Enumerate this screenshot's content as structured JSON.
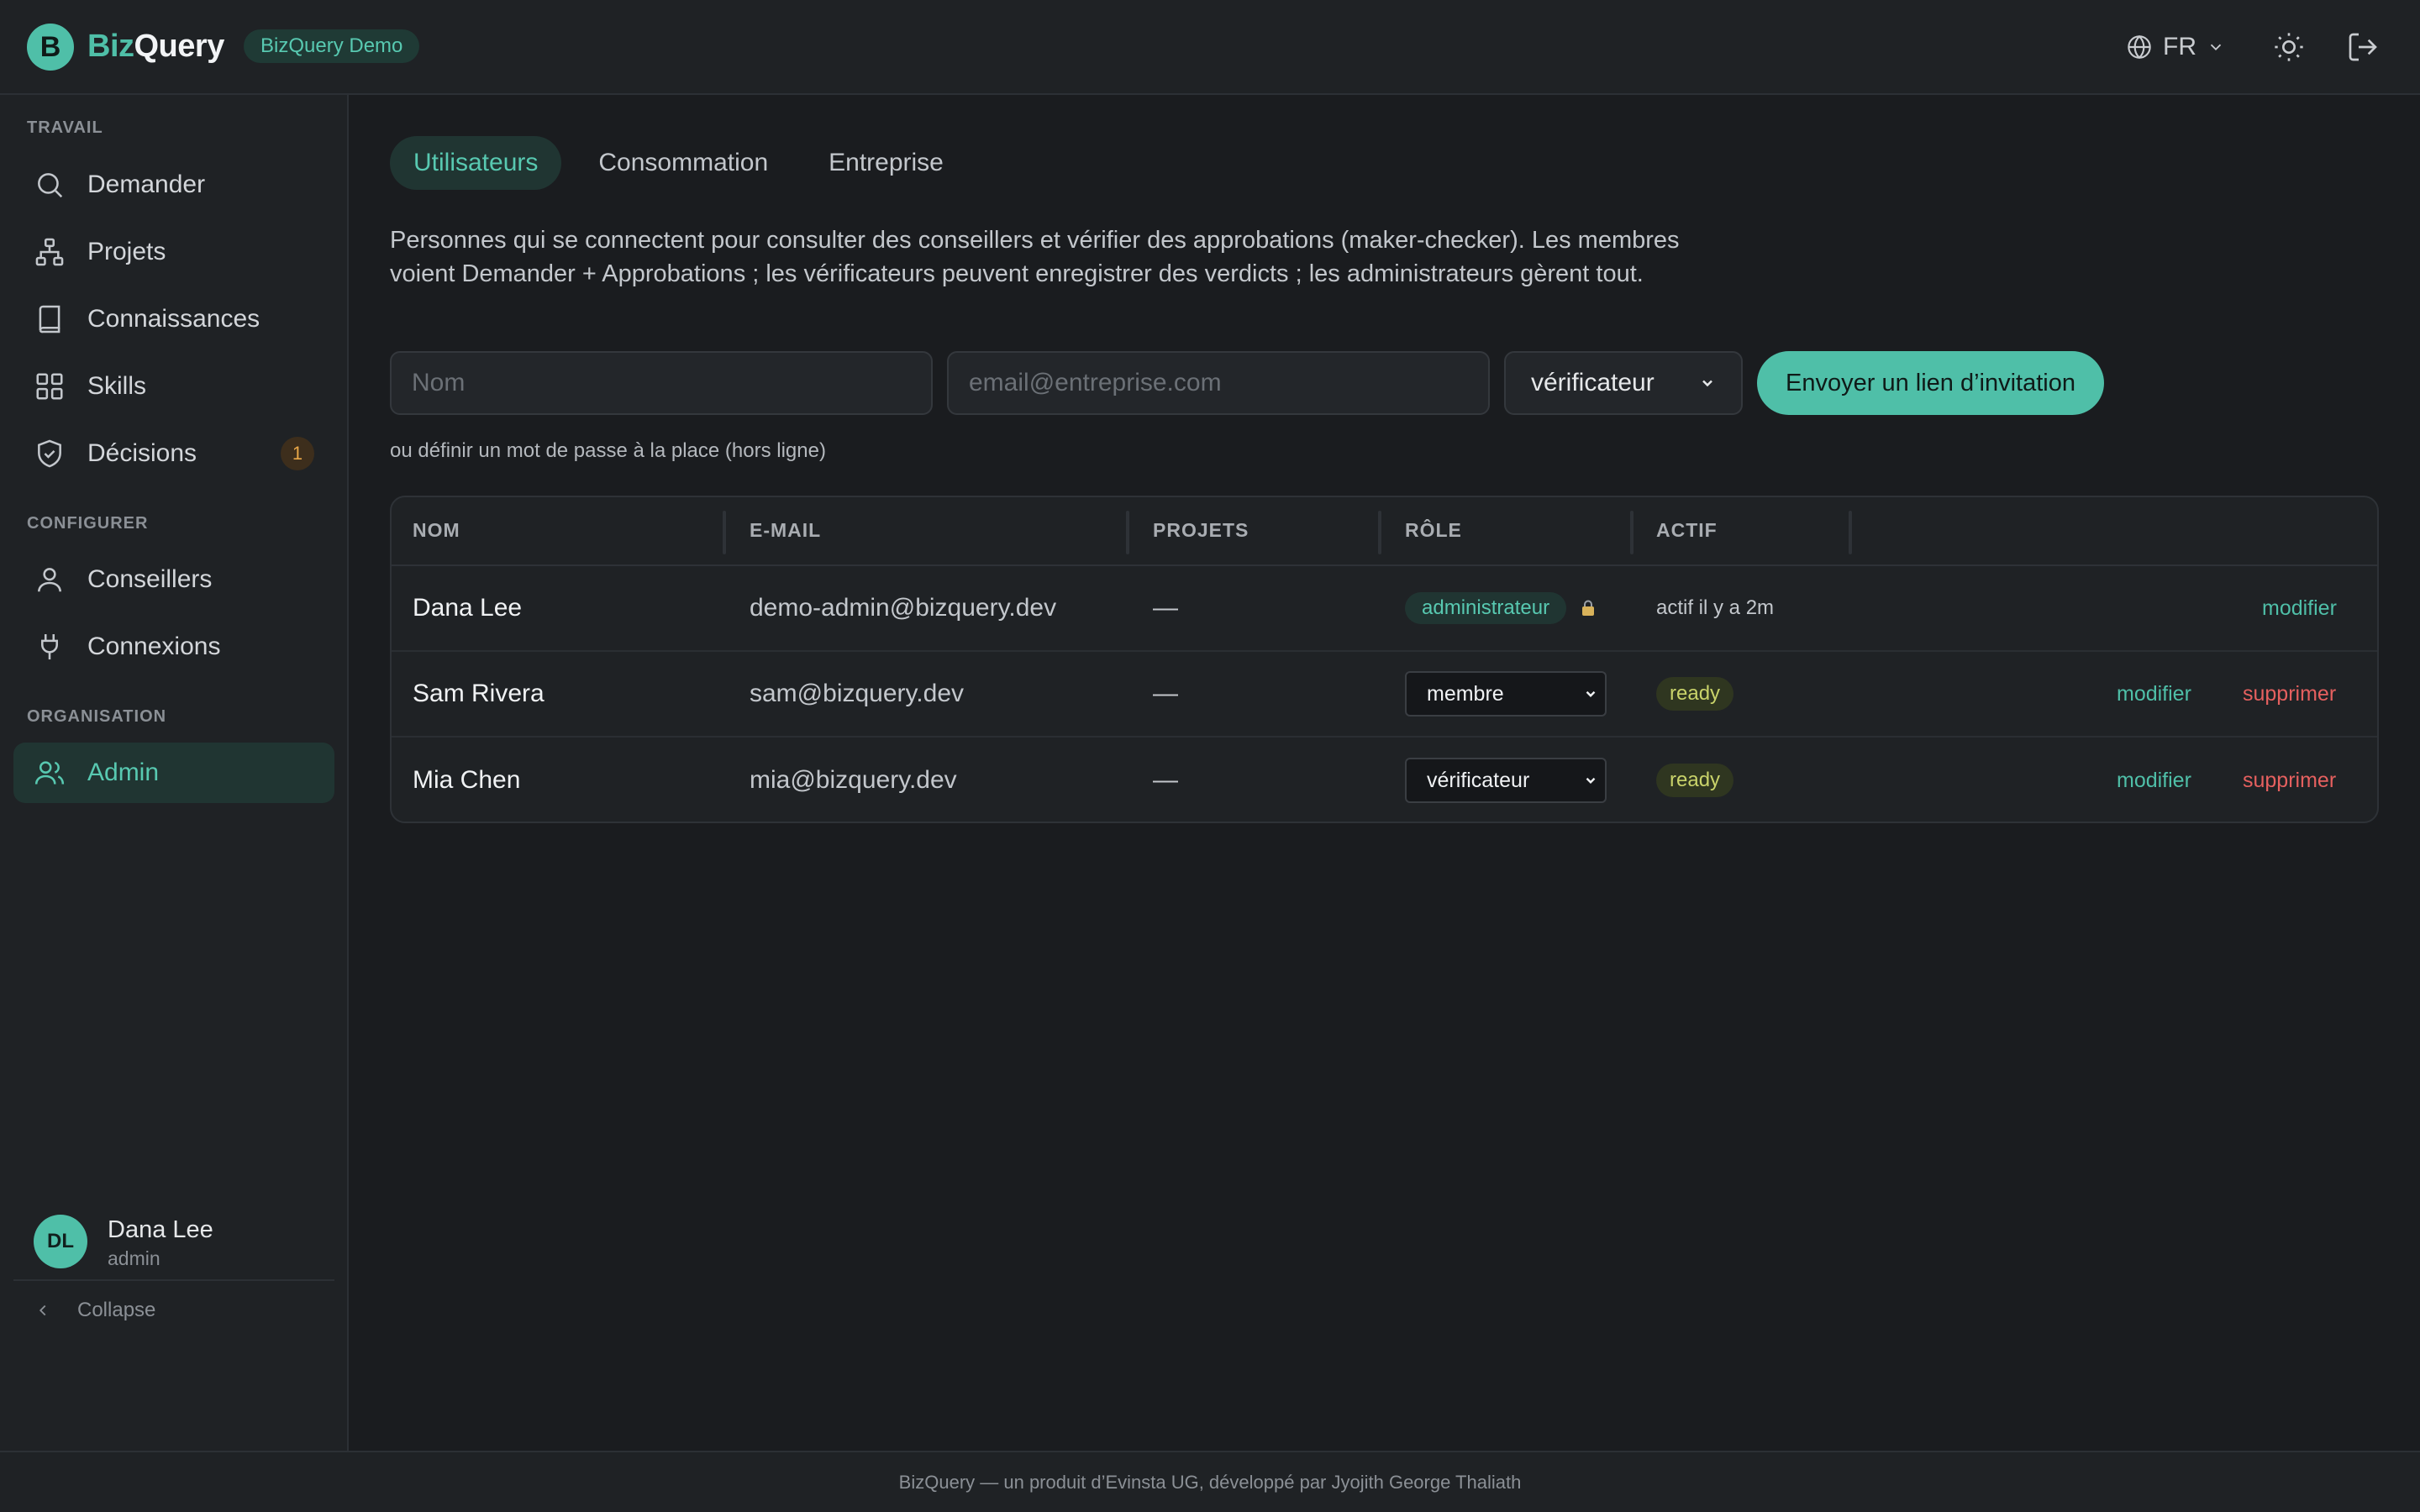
{
  "app": {
    "logo_letter": "B",
    "brand_part1": "Biz",
    "brand_part2": "Query",
    "demo_badge": "BizQuery Demo",
    "language": "FR",
    "accent_color": "#4fbfa8"
  },
  "topbar": {
    "icons": [
      "globe-icon",
      "chevron-down-icon",
      "sun-icon",
      "logout-icon"
    ]
  },
  "sidebar": {
    "sections": {
      "work": "TRAVAIL",
      "configure": "CONFIGURER",
      "organisation": "ORGANISATION"
    },
    "items": {
      "ask": "Demander",
      "projects": "Projets",
      "knowledge": "Connaissances",
      "skills": "Skills",
      "decisions": "Décisions",
      "decisions_badge": "1",
      "advisors": "Conseillers",
      "connections": "Connexions",
      "admin": "Admin"
    },
    "user": {
      "initials": "DL",
      "name": "Dana Lee",
      "role": "admin"
    },
    "collapse_label": "Collapse"
  },
  "tabs": {
    "users": "Utilisateurs",
    "consumption": "Consommation",
    "company": "Entreprise"
  },
  "description": "Personnes qui se connectent pour consulter des conseillers et vérifier des approbations (maker-checker). Les membres voient Demander + Approbations ; les vérificateurs peuvent enregistrer des verdicts ; les administrateurs gèrent tout.",
  "invite": {
    "name_placeholder": "Nom",
    "email_placeholder": "email@entreprise.com",
    "role_selected": "vérificateur",
    "send_label": "Envoyer un lien d’invitation",
    "password_note": "ou définir un mot de passe à la place (hors ligne)"
  },
  "table": {
    "headers": {
      "name": "NOM",
      "email": "E-MAIL",
      "projects": "PROJETS",
      "role": "RÔLE",
      "active": "ACTIF"
    },
    "rows": [
      {
        "name": "Dana Lee",
        "email": "demo-admin@bizquery.dev",
        "projects": "—",
        "role": "administrateur",
        "active": "actif il y a 2m",
        "modify": "modifier"
      },
      {
        "name": "Sam Rivera",
        "email": "sam@bizquery.dev",
        "projects": "—",
        "role": "membre",
        "active": "ready",
        "modify": "modifier",
        "delete": "supprimer"
      },
      {
        "name": "Mia Chen",
        "email": "mia@bizquery.dev",
        "projects": "—",
        "role": "vérificateur",
        "active": "ready",
        "modify": "modifier",
        "delete": "supprimer"
      }
    ]
  },
  "footer": "BizQuery — un produit d’Evinsta UG, développé par Jyojith George Thaliath"
}
